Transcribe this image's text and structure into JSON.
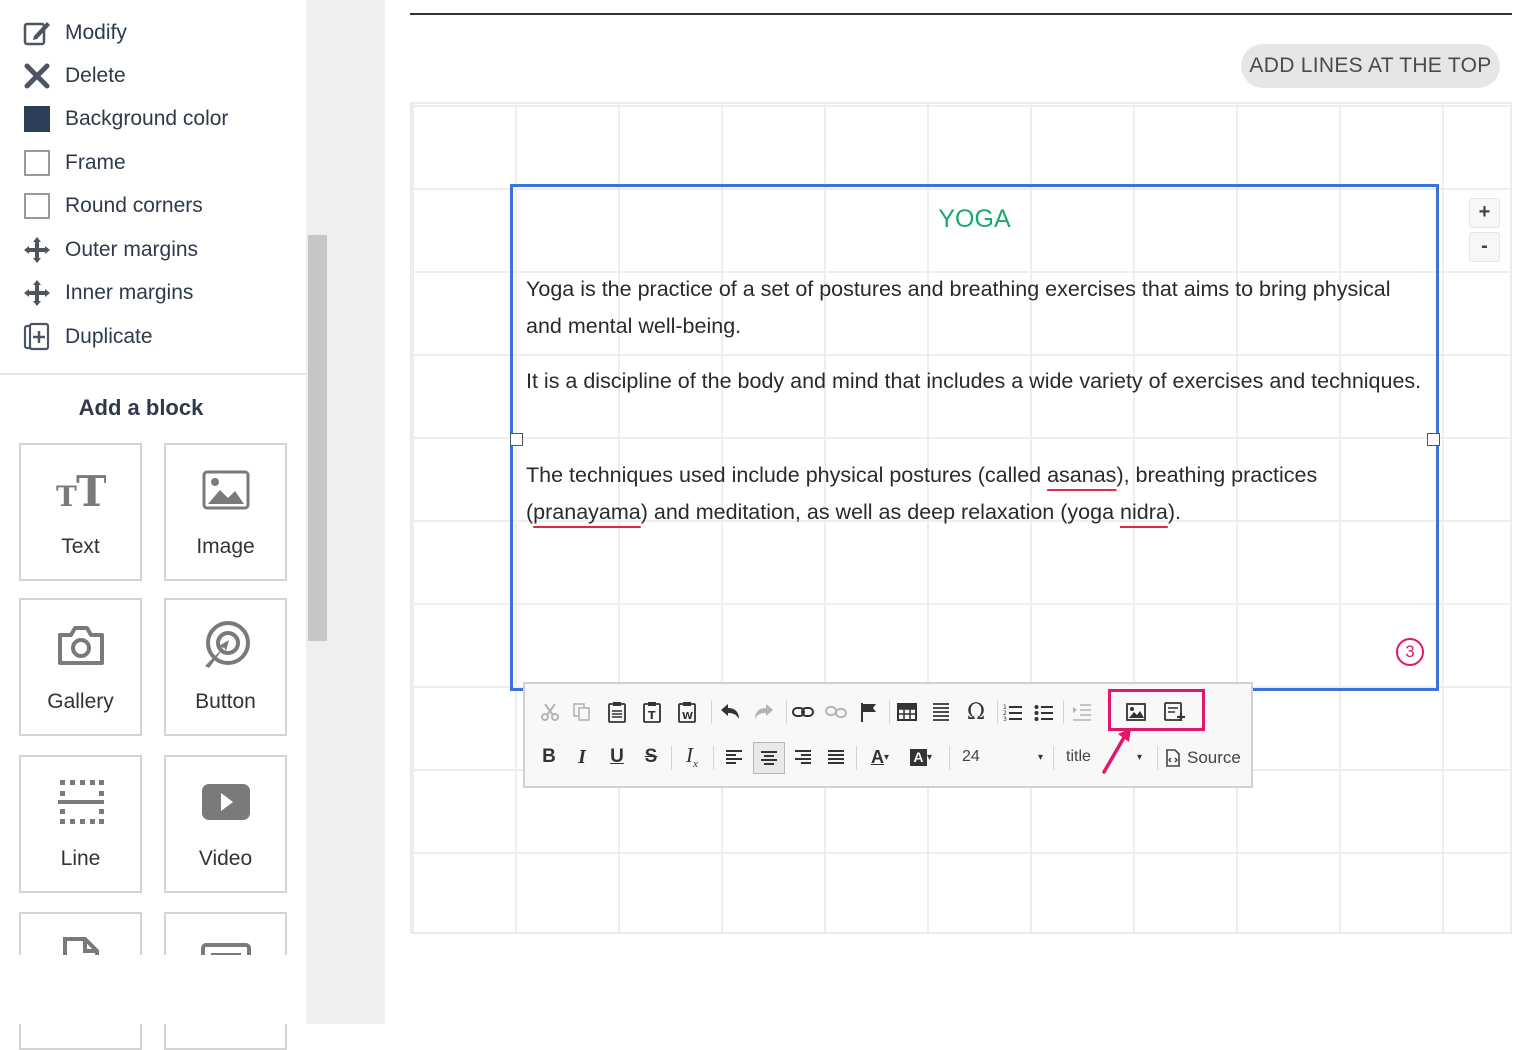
{
  "sidebar": {
    "menu": [
      {
        "label": "Modify",
        "icon": "edit-icon"
      },
      {
        "label": "Delete",
        "icon": "close-icon"
      },
      {
        "label": "Background color",
        "icon": "color-swatch-icon"
      },
      {
        "label": "Frame",
        "icon": "checkbox-icon"
      },
      {
        "label": "Round corners",
        "icon": "checkbox-icon"
      },
      {
        "label": "Outer margins",
        "icon": "move-arrows-icon"
      },
      {
        "label": "Inner margins",
        "icon": "move-arrows-icon"
      },
      {
        "label": "Duplicate",
        "icon": "duplicate-icon"
      }
    ],
    "add_block_title": "Add a block",
    "blocks": [
      {
        "label": "Text",
        "icon": "text-icon"
      },
      {
        "label": "Image",
        "icon": "image-icon"
      },
      {
        "label": "Gallery",
        "icon": "camera-icon"
      },
      {
        "label": "Button",
        "icon": "pointer-click-icon"
      },
      {
        "label": "Line",
        "icon": "line-icon"
      },
      {
        "label": "Video",
        "icon": "play-icon"
      }
    ]
  },
  "main": {
    "add_lines_button": "ADD LINES AT THE TOP",
    "zoom_in": "+",
    "zoom_out": "-",
    "text_block": {
      "title": "YOGA",
      "p1": "Yoga is the practice of a set of postures and breathing exercises that aims to bring physical and mental well-being.",
      "p2": "It is a discipline of the body and mind that includes a wide variety of exercises and techniques.",
      "p3": {
        "a": "The techniques used include physical postures (called ",
        "w1": "asanas",
        "b": "), breathing practices (",
        "w2": "pranayama",
        "c": ") and meditation, as well as deep relaxation (yoga ",
        "w3": "nidra",
        "d": ")."
      },
      "step_badge": "3"
    },
    "toolbar": {
      "font_size": "24",
      "style": "title",
      "source_label": "Source"
    }
  },
  "colors": {
    "accent_blue": "#3b73de",
    "title_green": "#1aab6b",
    "highlight_pink": "#e2156f",
    "spell_red": "#e02946"
  }
}
